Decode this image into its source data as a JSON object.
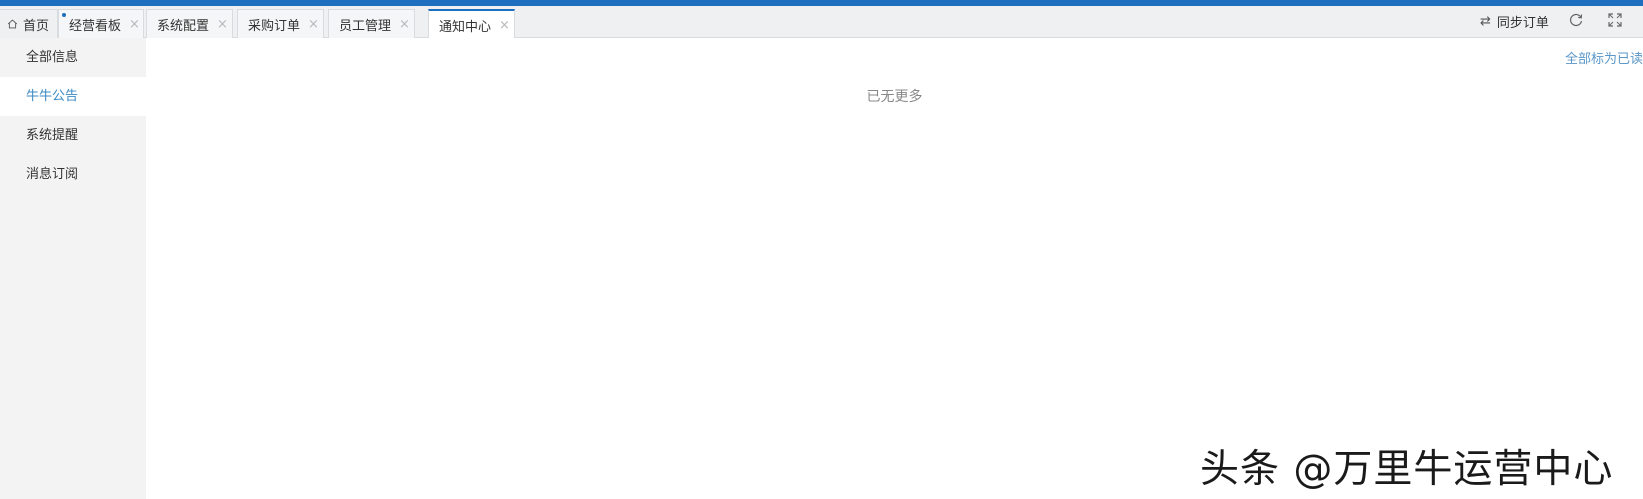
{
  "tabs": [
    {
      "label": "首页",
      "icon": "home-icon",
      "closable": false
    },
    {
      "label": "经营看板",
      "closable": true,
      "has_dot": true
    },
    {
      "label": "系统配置",
      "closable": true
    },
    {
      "label": "采购订单",
      "closable": true
    },
    {
      "label": "员工管理",
      "closable": true
    },
    {
      "label": "通知中心",
      "closable": true,
      "active": true
    }
  ],
  "tab_close_glyph": "×",
  "toolbar": {
    "sync_label": "同步订单",
    "sync_icon": "sync-arrows-icon",
    "refresh_icon": "refresh-icon",
    "fullscreen_icon": "fullscreen-icon"
  },
  "sidebar": {
    "items": [
      {
        "label": "全部信息",
        "active": false
      },
      {
        "label": "牛牛公告",
        "active": true
      },
      {
        "label": "系统提醒",
        "active": false
      },
      {
        "label": "消息订阅",
        "active": false
      }
    ]
  },
  "main": {
    "mark_all_read": "全部标为已读",
    "empty_text": "已无更多"
  },
  "watermark": {
    "text": "头条 @万里牛运营中心"
  },
  "colors": {
    "accent": "#1e6fc0",
    "link": "#5b97c8",
    "active_side": "#3b8ac4"
  }
}
